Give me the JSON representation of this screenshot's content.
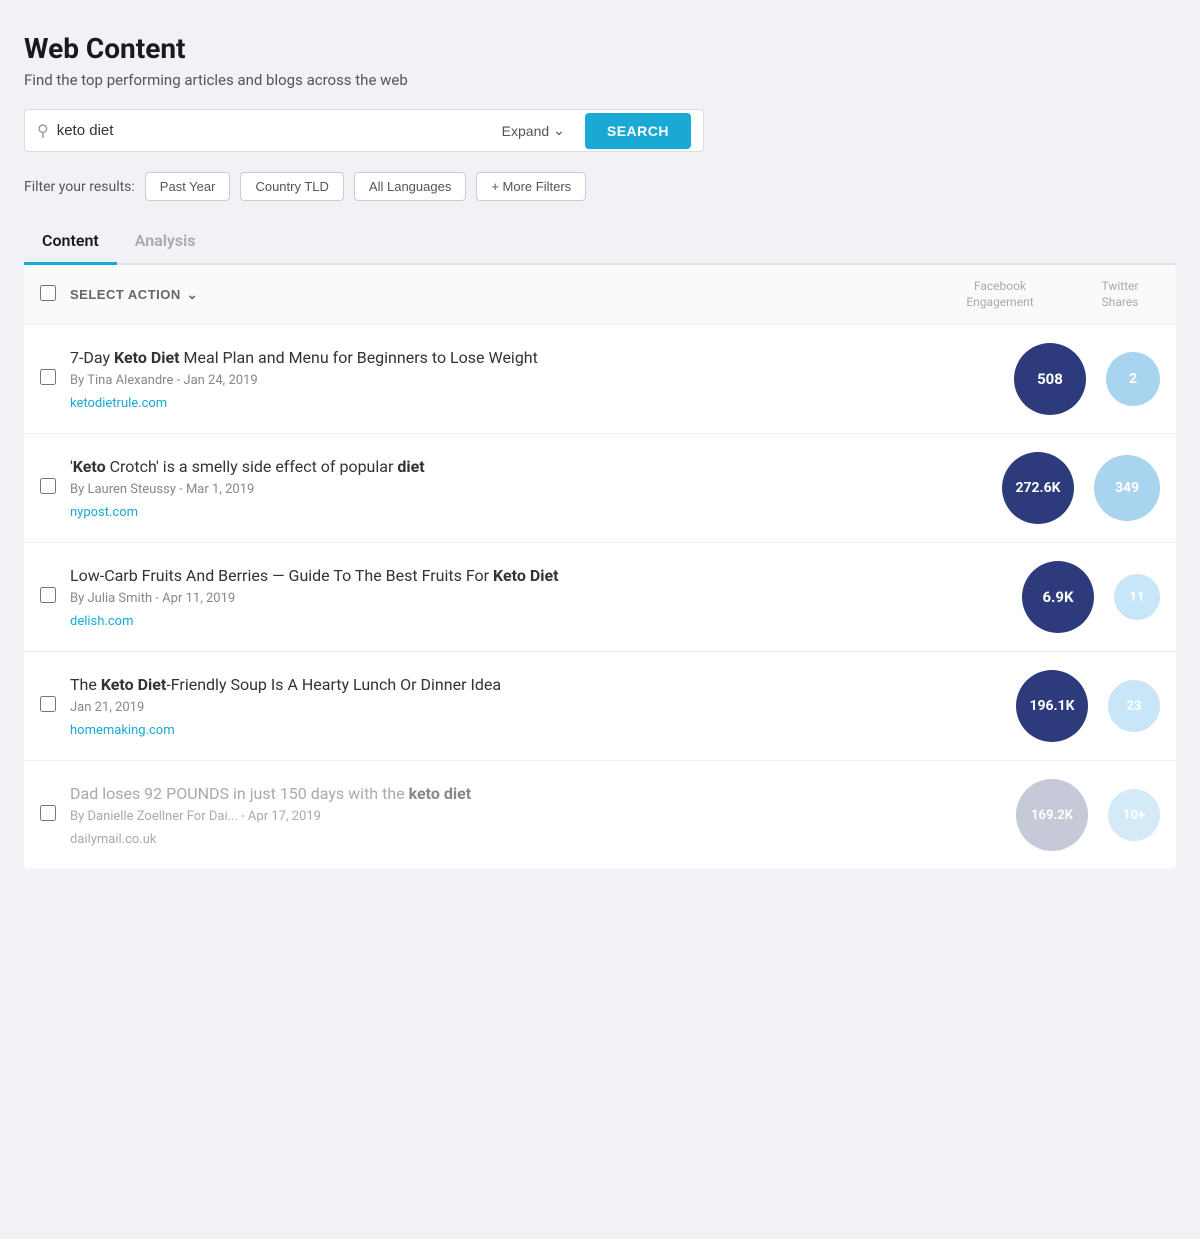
{
  "page": {
    "title": "Web Content",
    "subtitle": "Find the top performing articles and blogs across the web"
  },
  "search": {
    "value": "keto diet",
    "expand_label": "Expand",
    "search_label": "SEARCH"
  },
  "filters": {
    "label": "Filter your results:",
    "buttons": [
      {
        "id": "past-year",
        "label": "Past Year"
      },
      {
        "id": "country-tld",
        "label": "Country TLD"
      },
      {
        "id": "all-languages",
        "label": "All Languages"
      },
      {
        "id": "more-filters",
        "label": "+ More Filters"
      }
    ]
  },
  "tabs": [
    {
      "id": "content",
      "label": "Content",
      "active": true
    },
    {
      "id": "analysis",
      "label": "Analysis",
      "active": false
    }
  ],
  "table": {
    "select_action_label": "SELECT ACTION",
    "col_headers": [
      {
        "id": "facebook",
        "label": "Facebook\nEngagement"
      },
      {
        "id": "twitter",
        "label": "Twitter\nShares"
      }
    ],
    "articles": [
      {
        "id": 1,
        "title_html": "7-Day <strong>Keto Diet</strong> Meal Plan and Menu for Beginners to Lose Weight",
        "meta": "By Tina Alexandre - Jan 24, 2019",
        "link": "ketodietrule.com",
        "facebook_value": "508",
        "twitter_value": "2",
        "fb_circle": "dark",
        "tw_circle": "light",
        "fb_size": 72,
        "tw_size": 54,
        "faded": false
      },
      {
        "id": 2,
        "title_html": "'<strong>Keto</strong> Crotch' is a smelly side effect of popular <strong>diet</strong>",
        "meta": "By Lauren Steussy - Mar 1, 2019",
        "link": "nypost.com",
        "facebook_value": "272.6K",
        "twitter_value": "349",
        "fb_circle": "dark",
        "tw_circle": "light",
        "fb_size": 72,
        "tw_size": 66,
        "faded": false
      },
      {
        "id": 3,
        "title_html": "Low-Carb Fruits And Berries — Guide To The Best Fruits For <strong>Keto Diet</strong>",
        "meta": "By Julia Smith - Apr 11, 2019",
        "link": "delish.com",
        "facebook_value": "6.9K",
        "twitter_value": "11",
        "fb_circle": "dark",
        "tw_circle": "very-light",
        "fb_size": 72,
        "tw_size": 46,
        "faded": false
      },
      {
        "id": 4,
        "title_html": "The <strong>Keto Diet</strong>-Friendly Soup Is A Hearty Lunch Or Dinner Idea",
        "meta": "Jan 21, 2019",
        "link": "homemaking.com",
        "facebook_value": "196.1K",
        "twitter_value": "23",
        "fb_circle": "dark",
        "tw_circle": "very-light",
        "fb_size": 72,
        "tw_size": 52,
        "faded": false
      },
      {
        "id": 5,
        "title_html": "Dad loses 92 POUNDS in just 150 days with the <strong>keto diet</strong>",
        "meta": "By Danielle Zoellner For Dai... - Apr 17, 2019",
        "link": "dailymail.co.uk",
        "facebook_value": "169.2K",
        "twitter_value": "10+",
        "fb_circle": "faded",
        "tw_circle": "twitter-faded",
        "fb_size": 72,
        "tw_size": 52,
        "faded": true
      }
    ]
  }
}
